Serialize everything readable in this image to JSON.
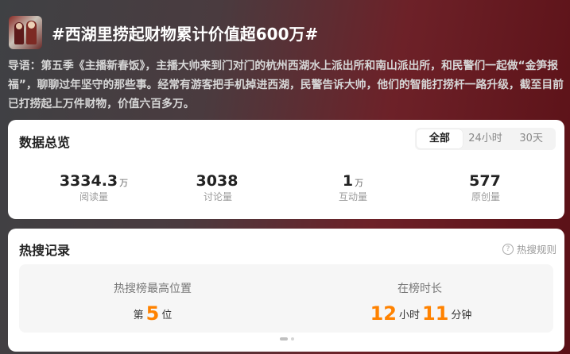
{
  "topic": {
    "title": "#西湖里捞起财物累计价值超600万#",
    "intro": "导语：第五季《主播新春饭》，主播大帅来到门对门的杭州西湖水上派出所和南山派出所，和民警们一起做“金笋报福”，聊聊过年坚守的那些事。经常有游客把手机掉进西湖，民警告诉大帅，他们的智能打捞杆一路升级，截至目前已打捞起上万件财物，价值六百多万。"
  },
  "overview": {
    "title": "数据总览",
    "tabs": [
      "全部",
      "24小时",
      "30天"
    ],
    "active_tab": "全部",
    "stats": [
      {
        "value": "3334.3",
        "unit": "万",
        "label": "阅读量"
      },
      {
        "value": "3038",
        "unit": "",
        "label": "讨论量"
      },
      {
        "value": "1",
        "unit": "万",
        "label": "互动量"
      },
      {
        "value": "577",
        "unit": "",
        "label": "原创量"
      }
    ]
  },
  "record": {
    "title": "热搜记录",
    "rules_label": "热搜规则",
    "peak_label": "热搜榜最高位置",
    "peak_prefix": "第",
    "peak_value": "5",
    "peak_suffix": "位",
    "duration_label": "在榜时长",
    "hours": "12",
    "hours_unit": "小时",
    "minutes": "11",
    "minutes_unit": "分钟"
  },
  "colors": {
    "accent": "#ff8200",
    "header_bg": "#6d2128"
  },
  "icons": {
    "rules": "question-circle-icon",
    "thumbnail": "topic-thumbnail-image"
  }
}
